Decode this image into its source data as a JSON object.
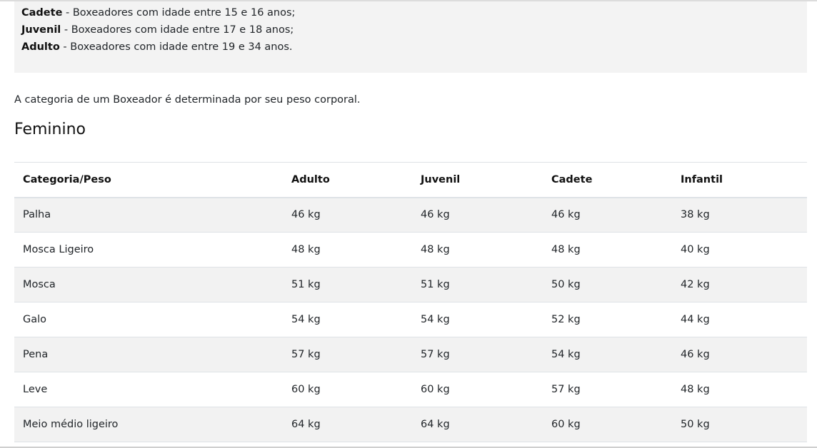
{
  "age_categories": [
    {
      "name": "Cadete",
      "desc": " - Boxeadores com idade entre 15 e 16 anos;"
    },
    {
      "name": "Juvenil",
      "desc": " - Boxeadores com idade entre 17 e 18 anos;"
    },
    {
      "name": "Adulto",
      "desc": " - Boxeadores com idade entre 19 e 34 anos."
    }
  ],
  "intro_text": "A categoria de um Boxeador é determinada por seu peso corporal.",
  "section_title": "Feminino",
  "table": {
    "headers": [
      "Categoria/Peso",
      "Adulto",
      "Juvenil",
      "Cadete",
      "Infantil"
    ],
    "rows": [
      [
        "Palha",
        "46 kg",
        "46 kg",
        "46 kg",
        "38 kg"
      ],
      [
        "Mosca Ligeiro",
        "48 kg",
        "48 kg",
        "48 kg",
        "40 kg"
      ],
      [
        "Mosca",
        "51 kg",
        "51 kg",
        "50 kg",
        "42 kg"
      ],
      [
        "Galo",
        "54 kg",
        "54 kg",
        "52 kg",
        "44 kg"
      ],
      [
        "Pena",
        "57 kg",
        "57 kg",
        "54 kg",
        "46 kg"
      ],
      [
        "Leve",
        "60 kg",
        "60 kg",
        "57 kg",
        "48 kg"
      ],
      [
        "Meio médio ligeiro",
        "64 kg",
        "64 kg",
        "60 kg",
        "50 kg"
      ]
    ]
  }
}
